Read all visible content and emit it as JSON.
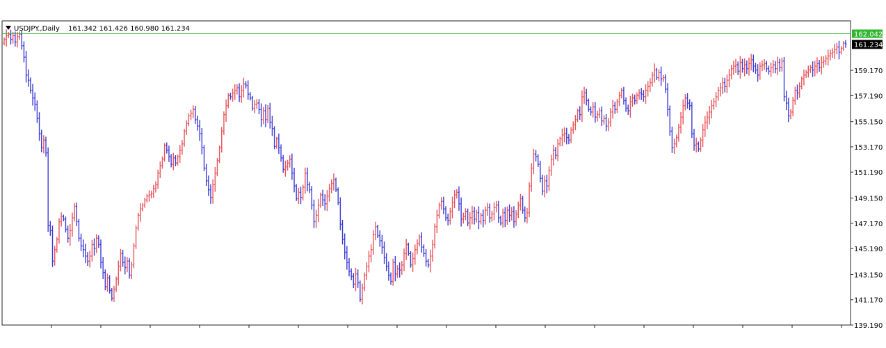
{
  "header": {
    "symbol": "USDJPY.,Daily",
    "ohlc": "161.342 161.426 160.980 161.234"
  },
  "colors": {
    "bull": "#e8545a",
    "bear": "#3b3bd8",
    "line_marker": "#2fb52f",
    "price_tag_bg": "#000000",
    "frame": "#222222"
  },
  "chart_data": {
    "type": "bar",
    "style": "ohlc-bars",
    "ylim": [
      139.19,
      163.05
    ],
    "yticks": [
      "159.170",
      "157.190",
      "155.150",
      "153.170",
      "151.190",
      "149.150",
      "147.170",
      "145.190",
      "143.150",
      "141.170",
      "139.190"
    ],
    "level_line": {
      "value": 162.042,
      "label": "162.042"
    },
    "last_price": {
      "value": 161.234,
      "label": "161.234"
    },
    "grid": false,
    "legend": "none",
    "close_series": [
      161.6,
      161.9,
      162.0,
      161.6,
      161.9,
      161.4,
      161.8,
      162.0,
      161.1,
      160.2,
      158.8,
      158.4,
      157.6,
      157.0,
      156.5,
      155.4,
      154.2,
      153.1,
      153.7,
      152.7,
      147.0,
      146.6,
      144.2,
      145.1,
      145.9,
      147.3,
      147.7,
      147.5,
      146.7,
      146.0,
      146.6,
      147.6,
      148.5,
      147.3,
      146.0,
      145.4,
      145.1,
      144.6,
      144.2,
      144.6,
      145.5,
      145.2,
      146.0,
      145.5,
      144.1,
      143.3,
      142.2,
      142.9,
      141.9,
      141.3,
      142.0,
      142.8,
      143.8,
      144.8,
      144.1,
      143.7,
      144.2,
      143.1,
      143.9,
      145.4,
      146.8,
      147.8,
      148.3,
      148.6,
      149.0,
      149.3,
      149.4,
      149.5,
      149.9,
      150.2,
      151.1,
      151.7,
      152.2,
      153.3,
      152.9,
      152.4,
      151.8,
      152.3,
      151.9,
      152.4,
      152.9,
      153.4,
      154.4,
      155.0,
      155.6,
      155.8,
      156.1,
      155.3,
      154.8,
      154.2,
      153.1,
      151.5,
      150.5,
      149.8,
      149.2,
      150.2,
      151.1,
      152.1,
      153.1,
      154.4,
      155.7,
      156.4,
      157.2,
      157.1,
      157.4,
      157.6,
      157.8,
      157.1,
      157.6,
      158.1,
      158.0,
      157.3,
      157.0,
      156.2,
      156.5,
      156.6,
      156.1,
      155.3,
      156.0,
      155.3,
      156.2,
      155.1,
      154.6,
      153.2,
      153.8,
      153.1,
      152.3,
      151.4,
      151.6,
      151.9,
      152.2,
      151.1,
      150.1,
      149.1,
      149.6,
      149.2,
      150.0,
      151.1,
      150.2,
      149.8,
      148.6,
      147.3,
      147.8,
      148.6,
      149.4,
      149.0,
      148.7,
      149.3,
      149.9,
      150.3,
      150.6,
      149.8,
      148.8,
      147.1,
      145.9,
      144.9,
      144.1,
      143.4,
      143.0,
      142.4,
      143.2,
      142.5,
      141.2,
      142.1,
      143.1,
      143.8,
      144.6,
      145.1,
      146.3,
      146.9,
      146.2,
      145.8,
      145.3,
      144.5,
      143.8,
      143.1,
      142.6,
      144.1,
      143.2,
      143.6,
      143.5,
      143.9,
      144.8,
      145.5,
      144.8,
      143.9,
      144.4,
      145.1,
      145.6,
      146.1,
      145.3,
      144.8,
      144.2,
      143.9,
      144.6,
      145.5,
      146.9,
      147.8,
      148.6,
      148.9,
      148.3,
      147.6,
      147.4,
      148.1,
      148.8,
      149.4,
      149.6,
      148.7,
      147.5,
      147.7,
      148.1,
      147.2,
      147.6,
      148.1,
      147.5,
      148.0,
      147.3,
      147.8,
      147.4,
      148.2,
      148.4,
      147.6,
      147.9,
      148.4,
      148.6,
      147.6,
      147.2,
      148.0,
      147.4,
      148.2,
      147.8,
      148.1,
      147.3,
      147.9,
      148.6,
      149.1,
      148.2,
      147.6,
      148.0,
      150.1,
      151.5,
      152.6,
      152.4,
      151.8,
      150.7,
      149.7,
      150.5,
      150.1,
      151.3,
      152.2,
      152.9,
      152.5,
      153.4,
      153.8,
      154.1,
      154.2,
      153.9,
      153.7,
      154.5,
      154.9,
      155.3,
      156.0,
      155.7,
      157.1,
      157.4,
      156.8,
      156.1,
      155.9,
      156.3,
      155.5,
      155.7,
      156.0,
      155.2,
      155.4,
      154.8,
      155.1,
      155.9,
      156.4,
      156.1,
      156.7,
      157.2,
      157.6,
      156.8,
      156.2,
      156.0,
      156.7,
      157.0,
      156.8,
      157.2,
      157.4,
      157.3,
      157.1,
      157.6,
      157.9,
      158.2,
      158.8,
      159.2,
      158.6,
      159.0,
      158.5,
      158.6,
      157.7,
      156.1,
      154.4,
      153.1,
      153.4,
      153.9,
      154.7,
      155.5,
      156.4,
      157.0,
      156.6,
      156.4,
      154.2,
      153.3,
      153.4,
      153.0,
      153.7,
      154.5,
      155.1,
      155.5,
      155.9,
      156.4,
      156.7,
      157.1,
      157.6,
      157.8,
      158.2,
      157.9,
      158.4,
      158.8,
      159.3,
      159.5,
      159.6,
      159.1,
      159.8,
      159.3,
      159.6,
      159.3,
      159.7,
      160.0,
      159.5,
      159.2,
      158.8,
      159.5,
      159.6,
      159.7,
      159.3,
      159.1,
      159.4,
      159.6,
      159.3,
      159.8,
      159.4,
      159.9,
      157.1,
      156.6,
      155.6,
      155.9,
      156.8,
      157.6,
      157.4,
      157.9,
      158.5,
      158.8,
      159.0,
      159.2,
      159.4,
      159.2,
      159.5,
      159.7,
      159.4,
      159.8,
      159.9,
      160.1,
      160.3,
      160.5,
      160.6,
      160.8,
      161.0,
      160.6,
      160.9,
      161.3,
      161.234
    ]
  }
}
